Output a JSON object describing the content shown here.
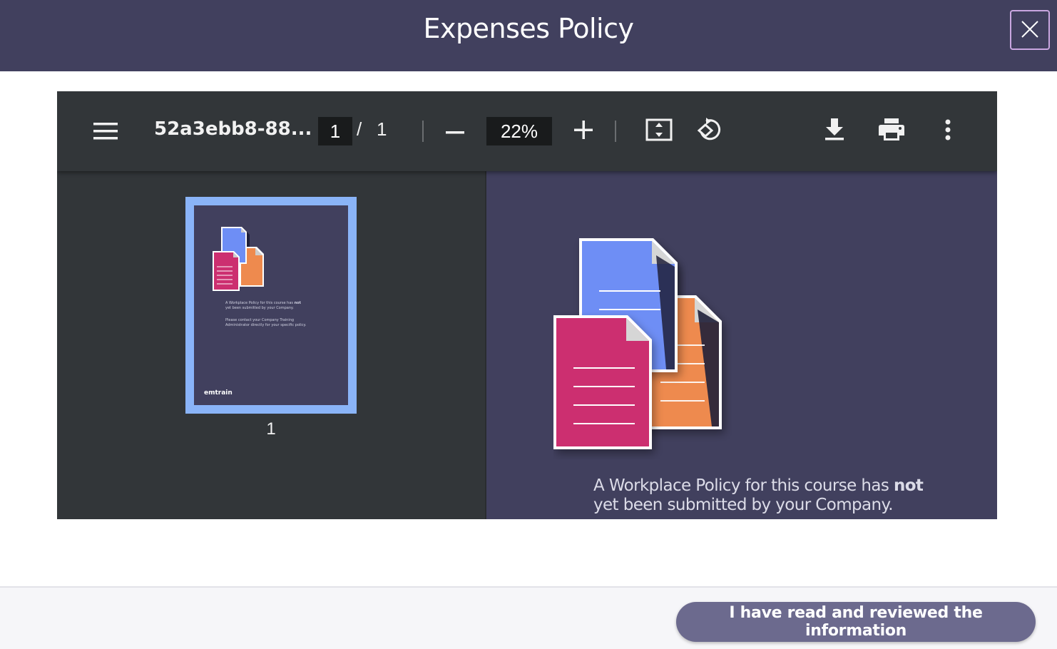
{
  "modal": {
    "title": "Expenses Policy",
    "close_icon": "close-icon"
  },
  "toolbar": {
    "menu_icon": "hamburger-menu-icon",
    "file_name": "52a3ebb8-88...",
    "current_page": "1",
    "page_separator": "/",
    "total_pages": "1",
    "zoom_out_icon": "minus-icon",
    "zoom_level": "22%",
    "zoom_in_icon": "plus-icon",
    "fit_page_icon": "fit-to-page-icon",
    "rotate_icon": "rotate-icon",
    "download_icon": "download-icon",
    "print_icon": "print-icon",
    "more_icon": "more-vertical-icon"
  },
  "sidebar": {
    "thumbnail_page_label": "1",
    "thumb_line1": "A Workplace Policy for this course has ",
    "thumb_line1_bold": "not",
    "thumb_line2": "yet been submitted by your Company.",
    "thumb_contact": "Please contact your Company Training Administrator directly for your specific policy.",
    "thumb_logo": "emtrain"
  },
  "document": {
    "message_part1": "A Workplace Policy for this course has ",
    "message_bold": "not",
    "message_line2": "yet been submitted by your Company.",
    "colors": {
      "blue_doc": "#6e8ef5",
      "orange_doc": "#ee8a4e",
      "pink_doc": "#cc2f70",
      "page_bg": "#41405e"
    }
  },
  "footer": {
    "acknowledge_button": "I have read and reviewed the information"
  }
}
